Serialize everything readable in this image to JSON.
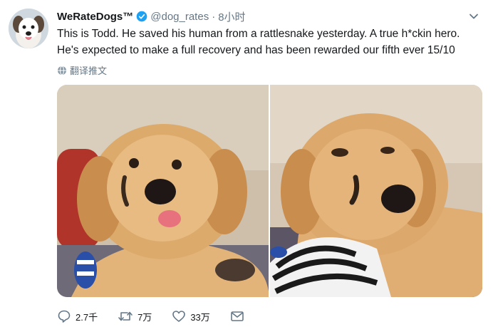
{
  "tweet": {
    "display_name": "WeRateDogs™",
    "handle": "@dog_rates",
    "separator": "·",
    "time_ago": "8小时",
    "text_lines": [
      "This is Todd. He saved his human from a rattlesnake yesterday. A true h*ckin hero.",
      "He's expected to make a full recovery and has been rewarded our fifth ever 15/10"
    ],
    "translate_label": "翻译推文"
  },
  "media": {
    "photos": [
      {
        "subject": "golden retriever puppy with tongue out lying on couch"
      },
      {
        "subject": "golden retriever puppy with swollen face next to zebra-print blanket"
      }
    ]
  },
  "actions": {
    "replies": "2.7千",
    "retweets": "7万",
    "likes": "33万"
  },
  "icons": {
    "verified": "verified-badge-icon",
    "caret": "chevron-down-icon",
    "translate": "globe-icon",
    "reply": "reply-icon",
    "retweet": "retweet-icon",
    "like": "heart-icon",
    "dm": "envelope-icon"
  },
  "colors": {
    "verified_blue": "#1da1f2",
    "text_primary": "#14171a",
    "text_secondary": "#657786"
  }
}
